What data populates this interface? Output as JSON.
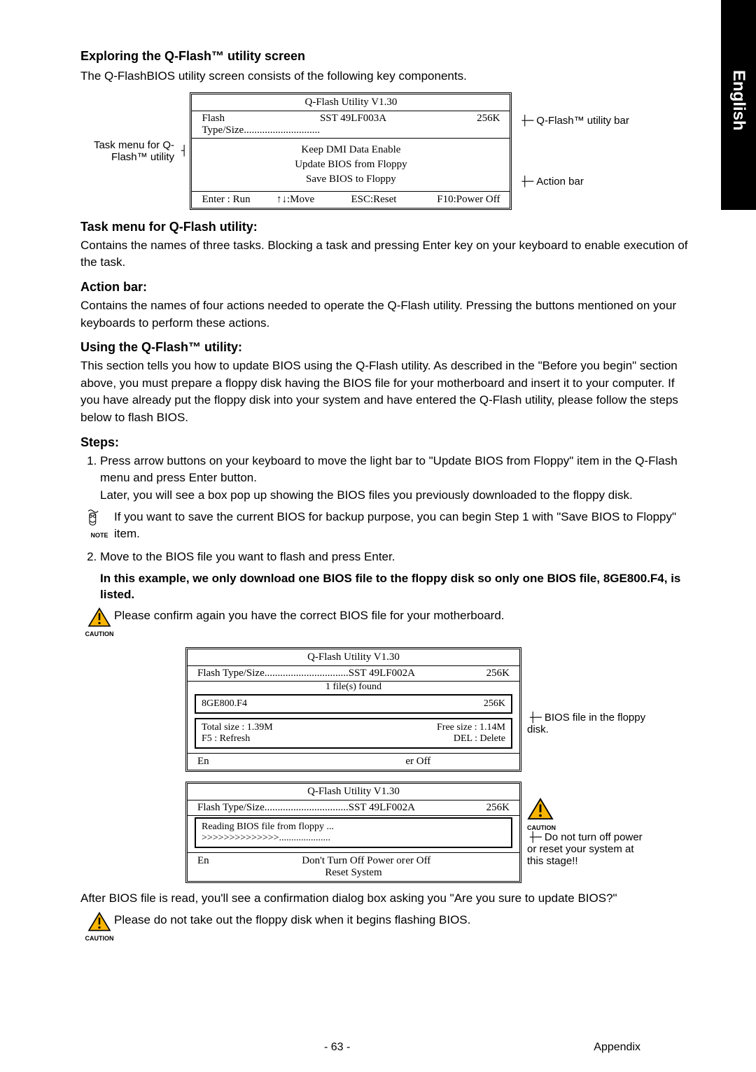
{
  "lang_tab": "English",
  "h_explore": "Exploring the Q-Flash™ utility screen",
  "intro": "The Q-FlashBIOS utility screen consists of the following key components.",
  "diagram1": {
    "left_label": "Task menu for Q-Flash™ utility",
    "right_label_top": "Q-Flash™ utility bar",
    "right_label_bottom": "Action bar",
    "title": "Q-Flash Utility V1.30",
    "flash_label": "Flash Type/Size",
    "flash_val": "SST 49LF003A",
    "flash_size": "256K",
    "menu1": "Keep DMI Data   Enable",
    "menu2": "Update BIOS from Floppy",
    "menu3": "Save BIOS to Floppy",
    "act1": "Enter : Run",
    "act2": "↑↓:Move",
    "act3": "ESC:Reset",
    "act4": "F10:Power Off"
  },
  "h_taskmenu": "Task menu for Q-Flash utility:",
  "p_taskmenu": "Contains the names of three tasks. Blocking a task and pressing Enter key on your keyboard to enable execution of the task.",
  "h_actionbar": "Action bar:",
  "p_actionbar": "Contains the names of four actions needed to operate the Q-Flash utility. Pressing the buttons mentioned on your keyboards to perform these actions.",
  "h_using": "Using the Q-Flash™ utility:",
  "p_using": "This section tells you how to update BIOS using the Q-Flash utility. As described in the \"Before you begin\" section above, you must prepare a floppy disk having the BIOS file for your motherboard and insert it to your computer. If you have already put the floppy disk into your system and have entered the Q-Flash utility, please follow the steps below to flash BIOS.",
  "h_steps": "Steps:",
  "step1a": "Press arrow buttons on your keyboard to move the light bar to \"Update BIOS from Floppy\" item in the Q-Flash menu and press Enter button.",
  "step1b": "Later, you will see a box pop up showing the BIOS files you previously downloaded to the floppy disk.",
  "note1": "If you want to save the current BIOS for backup purpose, you can begin Step 1 with \"Save BIOS to Floppy\" item.",
  "step2": "Move to the BIOS file you want to flash and press Enter.",
  "bold_note": "In this example, we only download one BIOS file to the floppy disk so only one BIOS file, 8GE800.F4, is listed.",
  "caution1": "Please confirm again you have the correct BIOS file for your motherboard.",
  "diagram2": {
    "title": "Q-Flash Utility V1.30",
    "flash_val": "SST 49LF002A",
    "flash_size": "256K",
    "files_found": "1 file(s) found",
    "file_name": "8GE800.F4",
    "file_size": "256K",
    "total": "Total size : 1.39M",
    "free": "Free size : 1.14M",
    "f5": "F5 : Refresh",
    "del": "DEL : Delete",
    "left_en": "En",
    "right_off": "er Off",
    "callout": "BIOS file in the floppy disk."
  },
  "diagram3": {
    "title": "Q-Flash Utility V1.30",
    "flash_val": "SST 49LF002A",
    "flash_size": "256K",
    "reading": "Reading BIOS file from floppy ...",
    "progress": ">>>>>>>>>>>>>>.....................",
    "warning": "Don't Turn Off Power or Reset System",
    "left_en": "En",
    "right_off": "er Off",
    "callout": "Do not turn off power or reset your system at this stage!!"
  },
  "after": "After BIOS file is read, you'll see a confirmation dialog box asking you \"Are you sure to update BIOS?\"",
  "caution2": "Please do not take out the floppy disk when it begins flashing BIOS.",
  "note_label": "NOTE",
  "caution_label": "CAUTION",
  "page_num": "- 63 -",
  "appendix": "Appendix"
}
